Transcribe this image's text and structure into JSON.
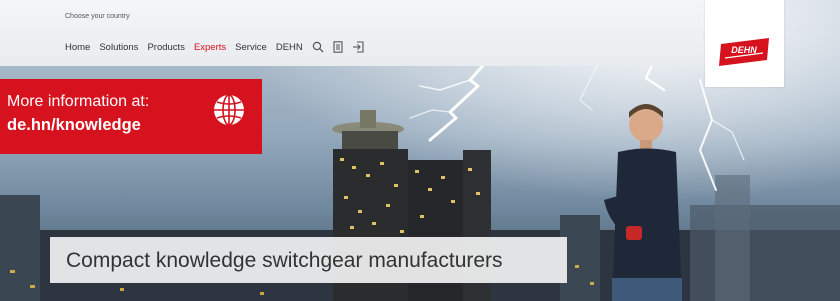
{
  "header": {
    "country_selector": "Choose your country",
    "nav_items": [
      {
        "label": "Home",
        "active": false
      },
      {
        "label": "Solutions",
        "active": false
      },
      {
        "label": "Products",
        "active": false
      },
      {
        "label": "Experts",
        "active": true
      },
      {
        "label": "Service",
        "active": false
      },
      {
        "label": "DEHN",
        "active": false
      }
    ],
    "icons": [
      "search-icon",
      "document-icon",
      "login-icon"
    ]
  },
  "logo": {
    "text": "DEHN"
  },
  "info_box": {
    "line1": "More information at:",
    "line2": "de.hn/knowledge",
    "icon": "globe-icon"
  },
  "caption": "Compact knowledge switchgear manufacturers",
  "colors": {
    "brand_red": "#d5121e",
    "nav_active": "#d5121e",
    "caption_bg": "#eeeeee"
  }
}
